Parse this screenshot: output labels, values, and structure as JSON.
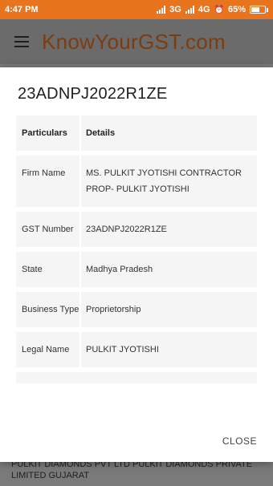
{
  "status_bar": {
    "time": "4:47 PM",
    "network_3g": "3G",
    "network_4g": "4G",
    "battery_percent": "65%",
    "battery_level": 0.65
  },
  "app_bar": {
    "menu_icon": "hamburger-menu-icon",
    "title": "KnowYourGST.com"
  },
  "background": {
    "text": "PULKIT DIAMONDS PVT LTD PULKIT DIAMONDS PRIVATE LIMITED Gujarat"
  },
  "dialog": {
    "title": "23ADNPJ2022R1ZE",
    "headers": {
      "label": "Particulars",
      "value": "Details"
    },
    "rows": [
      {
        "label": "Firm Name",
        "value": "MS. PULKIT JYOTISHI CONTRACTOR PROP- PULKIT JYOTISHI"
      },
      {
        "label": "GST Number",
        "value": "23ADNPJ2022R1ZE"
      },
      {
        "label": "State",
        "value": "Madhya Pradesh"
      },
      {
        "label": "Business Type",
        "value": "Proprietorship"
      },
      {
        "label": "Legal Name",
        "value": "PULKIT JYOTISHI"
      }
    ],
    "close_label": "CLOSE"
  }
}
